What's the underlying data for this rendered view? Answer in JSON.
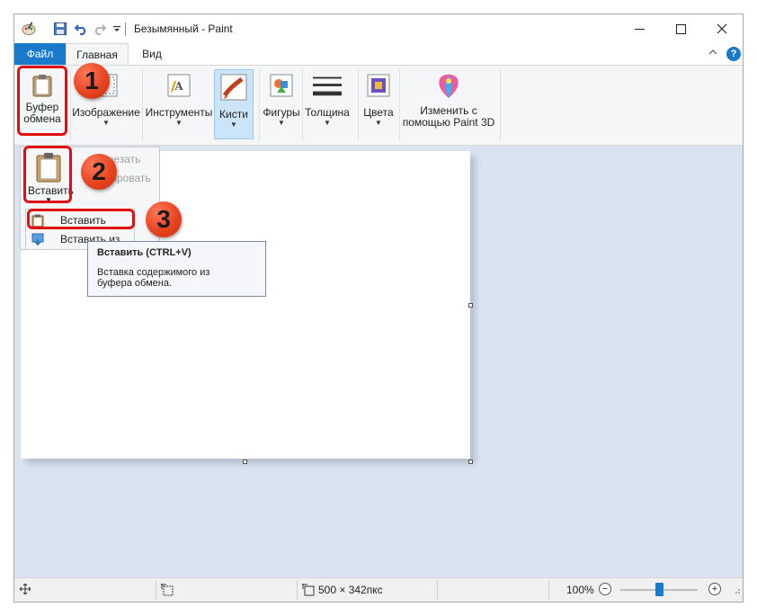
{
  "window": {
    "title": "Безымянный - Paint"
  },
  "tabs": {
    "file": "Файл",
    "home": "Главная",
    "view": "Вид"
  },
  "ribbon": {
    "clipboard": {
      "line1": "Буфер",
      "line2": "обмена"
    },
    "image": "Изображение",
    "tools": "Инструменты",
    "brushes": "Кисти",
    "shapes": "Фигуры",
    "size": "Толщина",
    "colors": "Цвета",
    "paint3d": {
      "line1": "Изменить с",
      "line2": "помощью Paint 3D"
    }
  },
  "clipboard_menu": {
    "paste_button": "Вставить",
    "cut": "Вырезать",
    "copy": "Копировать",
    "paste_items": [
      "Вставить",
      "Вставить из"
    ]
  },
  "tooltip": {
    "title": "Вставить (CTRL+V)",
    "text_line1": "Вставка содержимого из",
    "text_line2": "буфера обмена."
  },
  "badges": [
    "1",
    "2",
    "3"
  ],
  "status": {
    "canvas_size": "500 × 342пкс",
    "zoom": "100%"
  },
  "colors": {
    "accent": "#1979ca",
    "highlight": "#e01010",
    "workspace": "#dae3f0"
  },
  "zoom_level": 0.5
}
